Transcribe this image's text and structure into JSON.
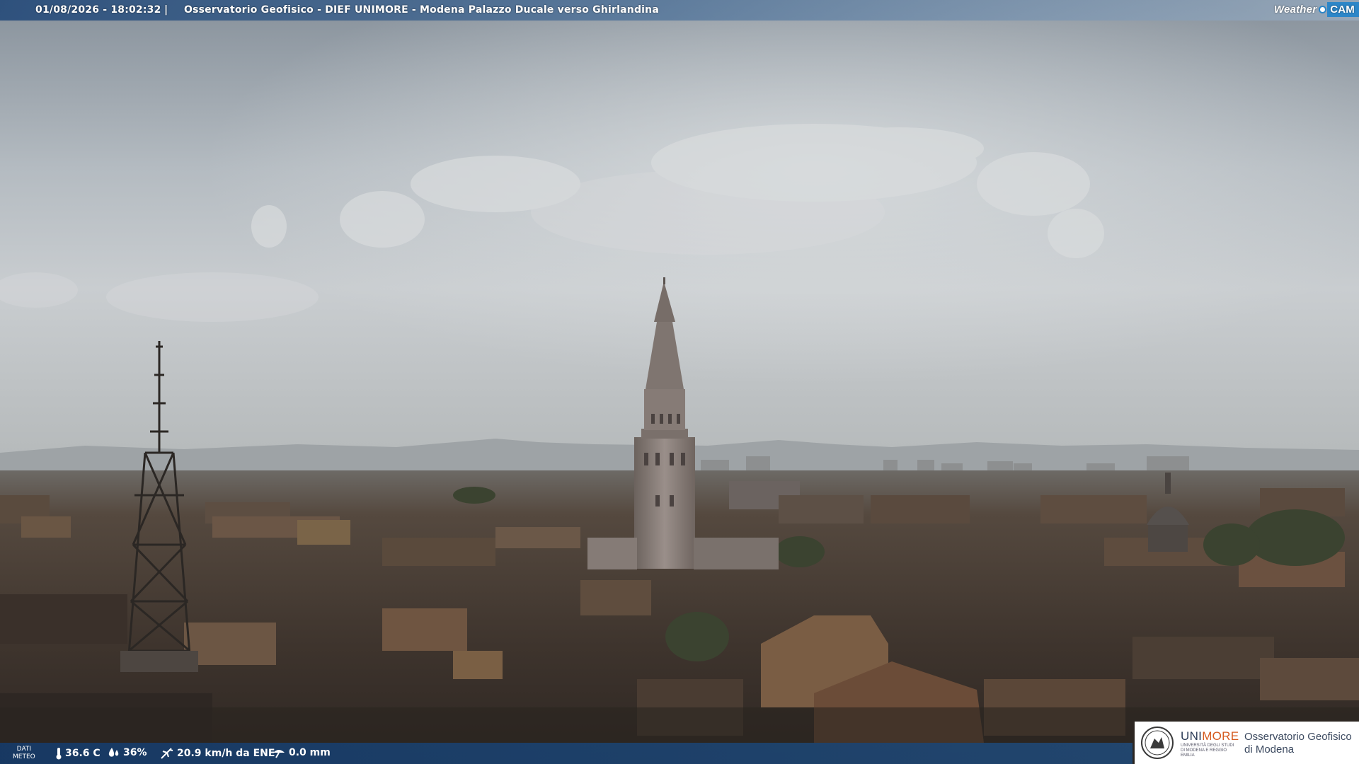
{
  "header": {
    "timestamp": "01/08/2026 - 18:02:32",
    "separator": "|",
    "camera_title": "Osservatorio Geofisico - DIEF UNIMORE - Modena Palazzo Ducale verso Ghirlandina"
  },
  "weathercam_logo": {
    "part1": "Weather",
    "part2": "CAM"
  },
  "weather": {
    "label_line1": "DATI",
    "label_line2": "METEO",
    "temperature": "36.6 C",
    "humidity": "36%",
    "wind": "20.9 km/h da ENE",
    "rain": "0.0 mm"
  },
  "unimore_logo": {
    "brand_a": "UNI",
    "brand_b": "MORE",
    "brand_sub": "UNIVERSITÀ DEGLI STUDI DI MODENA E REGGIO EMILIA",
    "obs_line1": "Osservatorio Geofisico",
    "obs_line2": "di Modena"
  },
  "colors": {
    "sky_top": "#8d969e",
    "sky_mid": "#c9ced2",
    "haze": "#b9bdbf",
    "city": "#3f3630",
    "roof": "#5a4a3e",
    "tower": "#8f8580",
    "bar_blue": "#1e508a"
  },
  "icons": [
    "thermometer-icon",
    "humidity-drop-icon",
    "wind-icon",
    "rain-gauge-icon",
    "weathercam-logo",
    "unimore-seal"
  ]
}
